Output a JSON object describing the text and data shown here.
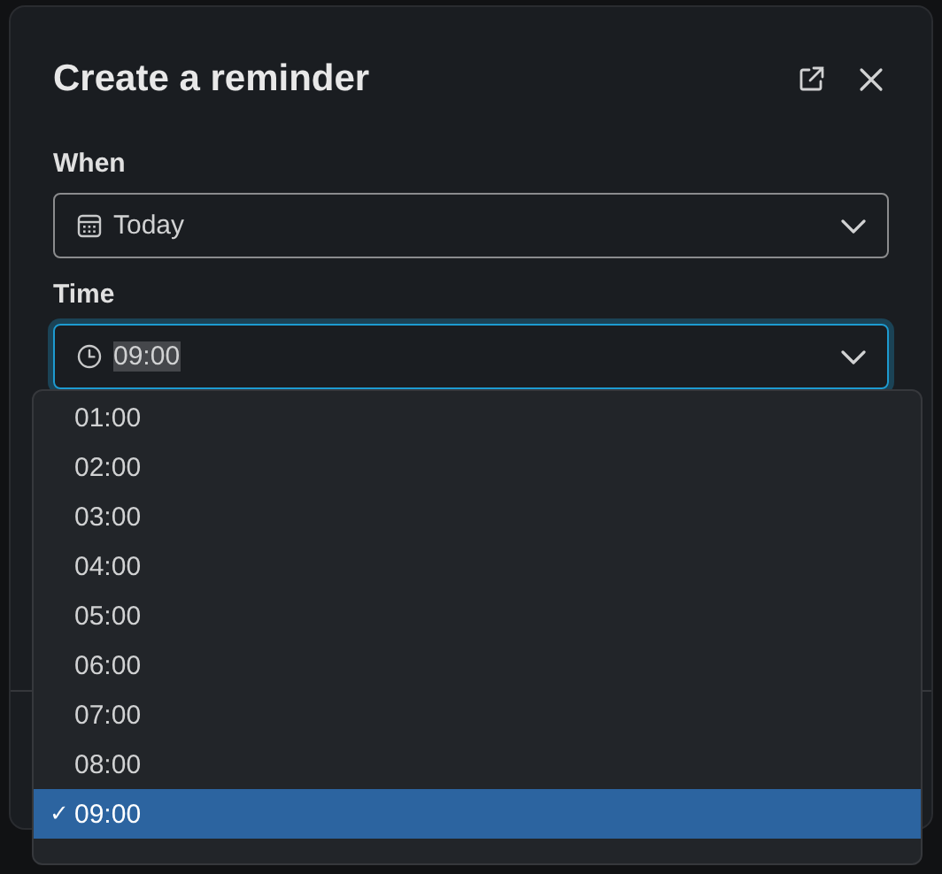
{
  "dialog": {
    "title": "Create a reminder",
    "when": {
      "label": "When",
      "value": "Today"
    },
    "time": {
      "label": "Time",
      "value": "09:00",
      "focused": true
    },
    "time_options": [
      {
        "label": "01:00",
        "selected": false
      },
      {
        "label": "02:00",
        "selected": false
      },
      {
        "label": "03:00",
        "selected": false
      },
      {
        "label": "04:00",
        "selected": false
      },
      {
        "label": "05:00",
        "selected": false
      },
      {
        "label": "06:00",
        "selected": false
      },
      {
        "label": "07:00",
        "selected": false
      },
      {
        "label": "08:00",
        "selected": false
      },
      {
        "label": "09:00",
        "selected": true
      }
    ],
    "check_mark": "✓"
  }
}
